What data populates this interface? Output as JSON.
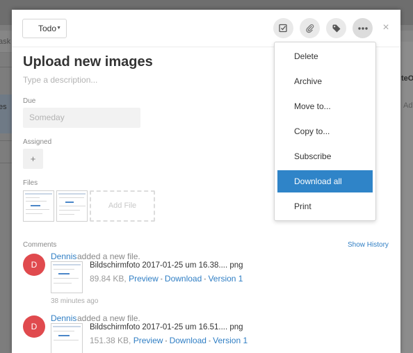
{
  "background": {
    "left_text": "ask",
    "left_item": "es",
    "right_text_1": "teO",
    "right_text_2": "Ade"
  },
  "header": {
    "status_label": "Todo",
    "icons": [
      "checkbox-icon",
      "paperclip-icon",
      "tag-icon",
      "more-icon",
      "close-icon"
    ],
    "close_glyph": "×"
  },
  "task": {
    "title": "Upload new images",
    "description_placeholder": "Type a description...",
    "due_label": "Due",
    "due_value": "Someday",
    "assigned_label": "Assigned",
    "assign_glyph": "+",
    "files_label": "Files",
    "add_file_label": "Add File"
  },
  "comments": {
    "label": "Comments",
    "show_history": "Show History",
    "items": [
      {
        "avatar_initial": "D",
        "author": "Dennis",
        "action": "added a new file.",
        "file_name": "Bildschirmfoto 2017-01-25 um 16.38.... png",
        "file_size": "89.84 KB,",
        "preview": "Preview",
        "download": "Download",
        "version": "Version 1",
        "time": "38 minutes ago"
      },
      {
        "avatar_initial": "D",
        "author": "Dennis",
        "action": "added a new file.",
        "file_name": "Bildschirmfoto 2017-01-25 um 16.51.... png",
        "file_size": "151.38 KB,",
        "preview": "Preview",
        "download": "Download",
        "version": "Version 1"
      }
    ]
  },
  "dropdown": {
    "items": [
      "Delete",
      "Archive",
      "Move to...",
      "Copy to...",
      "Subscribe",
      "Download all",
      "Print"
    ],
    "selected": "Download all"
  },
  "colors": {
    "accent": "#2f84c8",
    "link": "#2f7ec4",
    "avatar": "#e04a4e"
  }
}
